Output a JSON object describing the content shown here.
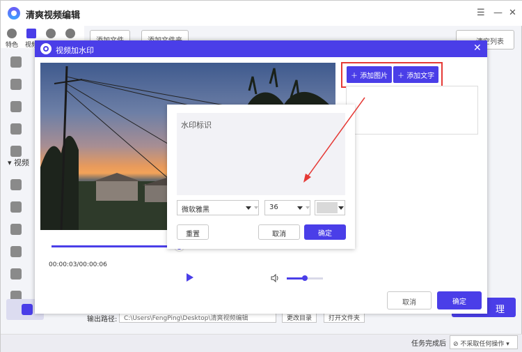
{
  "app": {
    "title": "清爽视频编辑",
    "menu_icon": "hamburger-icon",
    "window_controls": [
      "minimize-icon",
      "close-icon"
    ]
  },
  "top_tabs": [
    {
      "label": "特色",
      "icon": "gear-icon"
    },
    {
      "label": "视频",
      "icon": "film-icon",
      "active": true
    },
    {
      "label": "",
      "icon": "refresh-icon"
    },
    {
      "label": "",
      "icon": "ai-icon"
    }
  ],
  "sidebar": {
    "section_label": "视频"
  },
  "toolbar": {
    "add_file_label": "添加文件",
    "add_folder_label": "添加文件夹",
    "clear_list_label": "清空列表"
  },
  "output": {
    "label": "输出路径:",
    "path": "C:\\Users\\FengPing\\Desktop\\清爽视频编辑",
    "change_dir_label": "更改目录",
    "open_folder_label": "打开文件夹",
    "process_label": "理"
  },
  "status": {
    "task_label": "任务完成后",
    "task_value": "不采取任何操作"
  },
  "dialog": {
    "title": "视频加水印",
    "add_image_label": "添加图片",
    "add_text_label": "添加文字",
    "time": "00:00:03/00:00:06",
    "progress": 0.425,
    "volume": 0.5,
    "cancel_label": "取消",
    "ok_label": "确定"
  },
  "popup": {
    "text_value": "水印标识",
    "font": "微软雅黑",
    "size": "36",
    "color": "#d9d9d9",
    "reset_label": "重置",
    "cancel_label": "取消",
    "ok_label": "确定"
  },
  "colors": {
    "accent": "#4a3ee8",
    "highlight": "#e53935"
  }
}
